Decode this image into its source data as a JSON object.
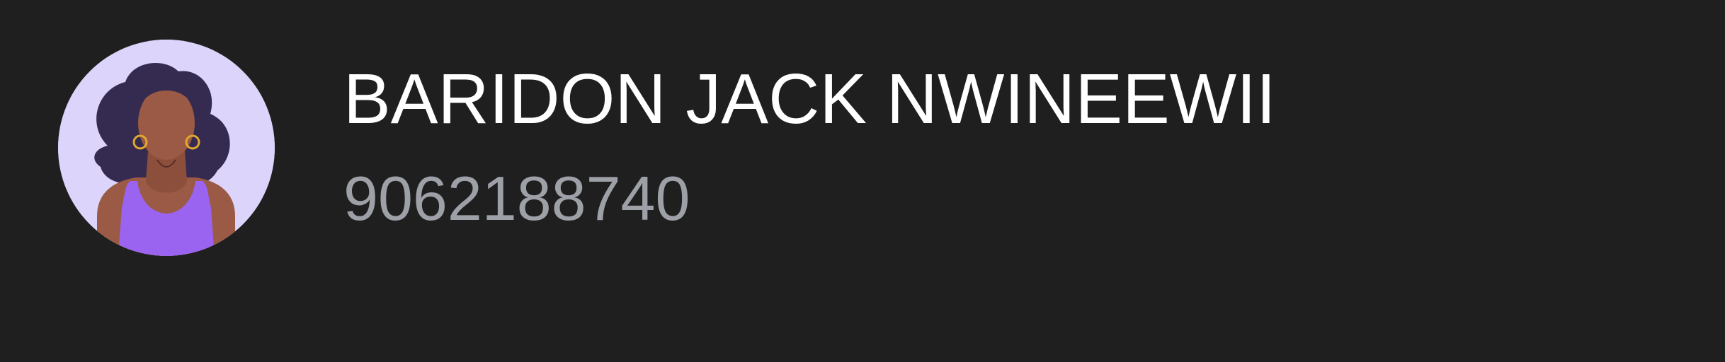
{
  "contact": {
    "name": "BARIDON JACK NWINEEWII",
    "phone": "9062188740",
    "avatar_icon": "woman-avatar-icon"
  },
  "colors": {
    "background": "#1f1f1f",
    "name_text": "#ffffff",
    "phone_text": "#9da0a6",
    "avatar_bg": "#dcd4fb",
    "hair": "#352a4f",
    "skin": "#9a5a45",
    "top": "#9b64f0",
    "earring": "#e0a82e"
  }
}
